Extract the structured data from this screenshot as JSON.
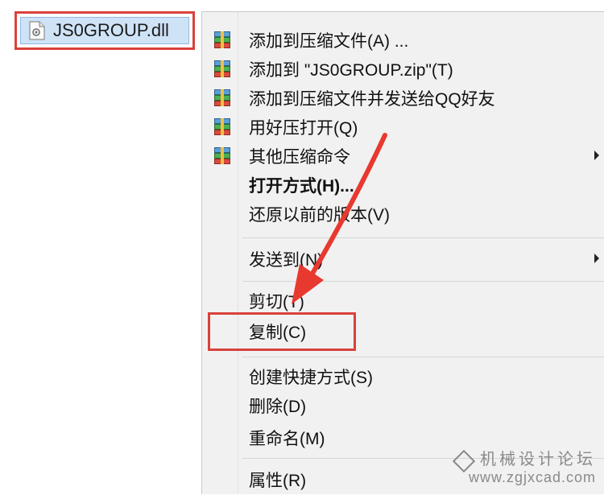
{
  "file": {
    "name": "JS0GROUP.dll",
    "icon": "dll-file-icon"
  },
  "menu": {
    "items": [
      {
        "label": "添加到压缩文件(A) ...",
        "icon": "archive-icon"
      },
      {
        "label": "添加到 \"JS0GROUP.zip\"(T)",
        "icon": "archive-icon"
      },
      {
        "label": "添加到压缩文件并发送给QQ好友",
        "icon": "archive-icon"
      },
      {
        "label": "用好压打开(Q)",
        "icon": "archive-icon"
      },
      {
        "label": "其他压缩命令",
        "icon": "archive-icon",
        "submenu": true
      },
      {
        "label": "打开方式(H)...",
        "bold": true
      },
      {
        "label": "还原以前的版本(V)"
      },
      {
        "label": "发送到(N)",
        "submenu": true
      },
      {
        "label": "剪切(T)"
      },
      {
        "label": "复制(C)",
        "highlighted": true
      },
      {
        "label": "创建快捷方式(S)"
      },
      {
        "label": "删除(D)"
      },
      {
        "label": "重命名(M)"
      },
      {
        "label": "属性(R)"
      }
    ]
  },
  "watermark": {
    "title": "机械设计论坛",
    "url": "www.zgjxcad.com"
  },
  "colors": {
    "highlight": "#d9413b",
    "arrow": "#e8392f",
    "selection": "#cfe3f7"
  }
}
